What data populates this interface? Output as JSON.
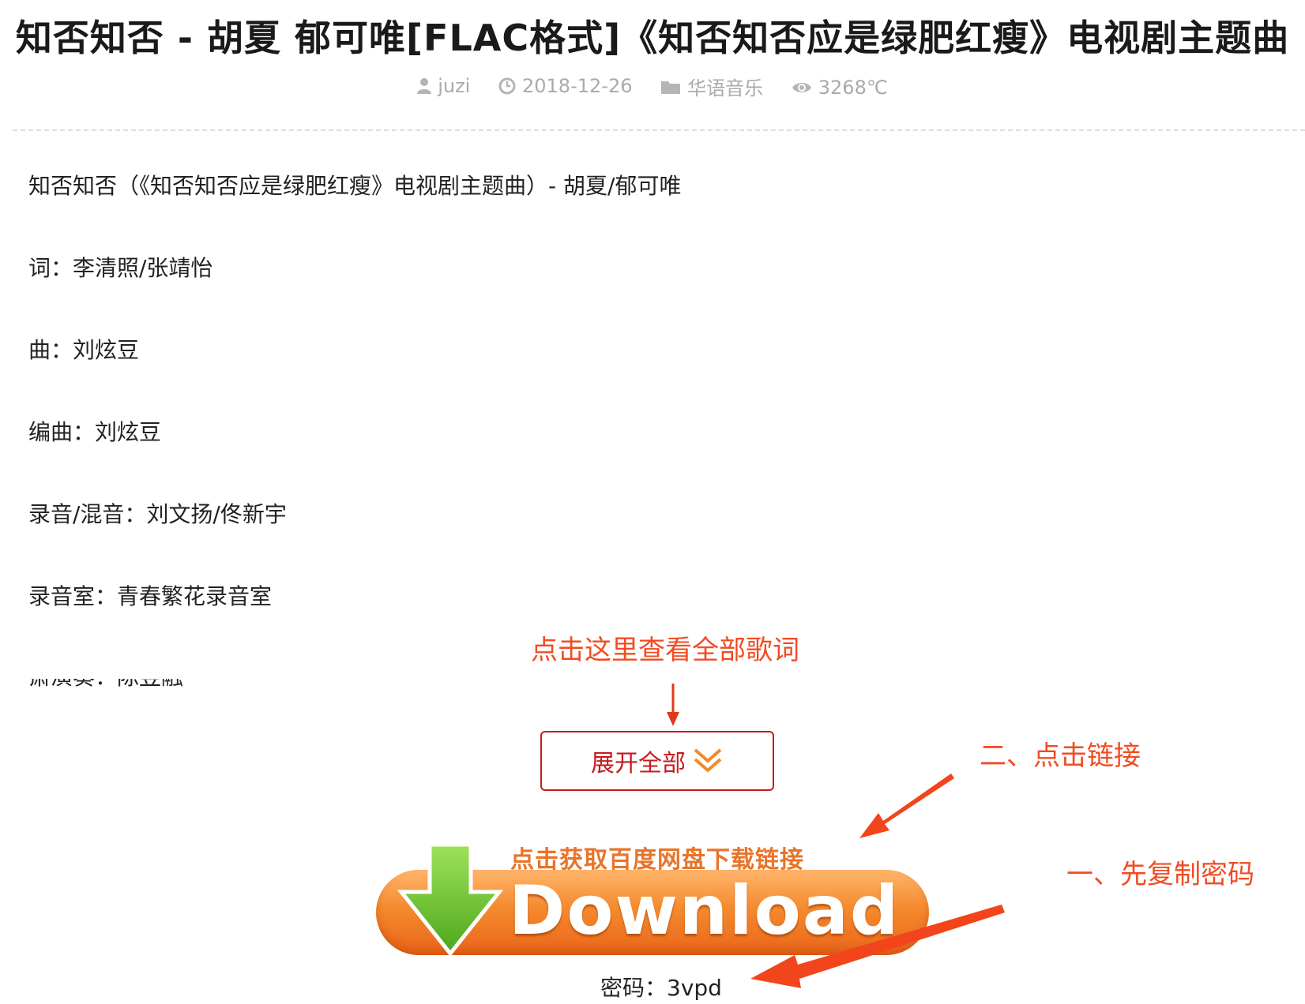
{
  "post": {
    "title": "知否知否 - 胡夏 郁可唯[FLAC格式]《知否知否应是绿肥红瘦》电视剧主题曲",
    "meta": {
      "author": "juzi",
      "date": "2018-12-26",
      "category": "华语音乐",
      "views": "3268℃"
    }
  },
  "content": {
    "lines": [
      "知否知否（《知否知否应是绿肥红瘦》电视剧主题曲）- 胡夏/郁可唯",
      "词：李清照/张靖怡",
      "曲：刘炫豆",
      "编曲：刘炫豆",
      "录音/混音：刘文扬/佟新宇",
      "录音室：青春繁花录音室",
      "箫演奏：陈昱融"
    ]
  },
  "annotations": {
    "view_all_hint": "点击这里查看全部歌词",
    "step_two": "二、点击链接",
    "step_one": "一、先复制密码"
  },
  "expand": {
    "label": "展开全部"
  },
  "download": {
    "caption": "点击获取百度网盘下载链接",
    "label": "Download"
  },
  "password": {
    "text": "密码：3vpd"
  },
  "colors": {
    "annotation": "#f24b22",
    "expand_border": "#c8191f",
    "download_orange": "#f58a2e",
    "download_arrow_green": "#6cc12a"
  }
}
